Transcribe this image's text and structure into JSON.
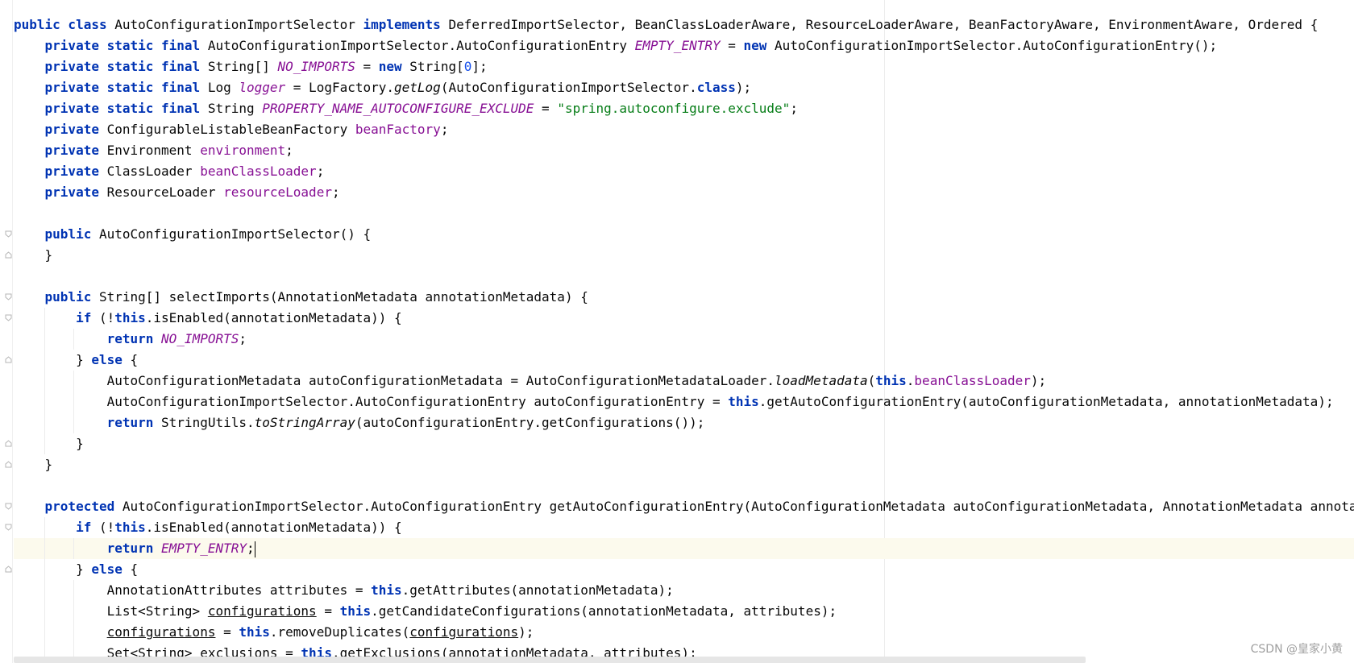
{
  "editor": {
    "lines": [
      [
        [
          "kw",
          "public class "
        ],
        [
          "t",
          "AutoConfigurationImportSelector "
        ],
        [
          "kw",
          "implements "
        ],
        [
          "t",
          "DeferredImportSelector, BeanClassLoaderAware, ResourceLoaderAware, BeanFactoryAware, EnvironmentAware, Ordered {"
        ]
      ],
      [
        [
          "t",
          "    "
        ],
        [
          "kw",
          "private static final "
        ],
        [
          "t",
          "AutoConfigurationImportSelector.AutoConfigurationEntry "
        ],
        [
          "const",
          "EMPTY_ENTRY"
        ],
        [
          "t",
          " = "
        ],
        [
          "kw",
          "new "
        ],
        [
          "t",
          "AutoConfigurationImportSelector.AutoConfigurationEntry();"
        ]
      ],
      [
        [
          "t",
          "    "
        ],
        [
          "kw",
          "private static final "
        ],
        [
          "t",
          "String[] "
        ],
        [
          "const",
          "NO_IMPORTS"
        ],
        [
          "t",
          " = "
        ],
        [
          "kw",
          "new "
        ],
        [
          "t",
          "String["
        ],
        [
          "num",
          "0"
        ],
        [
          "t",
          "];"
        ]
      ],
      [
        [
          "t",
          "    "
        ],
        [
          "kw",
          "private static final "
        ],
        [
          "t",
          "Log "
        ],
        [
          "const",
          "logger"
        ],
        [
          "t",
          " = LogFactory."
        ],
        [
          "sm",
          "getLog"
        ],
        [
          "t",
          "(AutoConfigurationImportSelector."
        ],
        [
          "kw",
          "class"
        ],
        [
          "t",
          ");"
        ]
      ],
      [
        [
          "t",
          "    "
        ],
        [
          "kw",
          "private static final "
        ],
        [
          "t",
          "String "
        ],
        [
          "const",
          "PROPERTY_NAME_AUTOCONFIGURE_EXCLUDE"
        ],
        [
          "t",
          " = "
        ],
        [
          "str",
          "\"spring.autoconfigure.exclude\""
        ],
        [
          "t",
          ";"
        ]
      ],
      [
        [
          "t",
          "    "
        ],
        [
          "kw",
          "private "
        ],
        [
          "t",
          "ConfigurableListableBeanFactory "
        ],
        [
          "field",
          "beanFactory"
        ],
        [
          "t",
          ";"
        ]
      ],
      [
        [
          "t",
          "    "
        ],
        [
          "kw",
          "private "
        ],
        [
          "t",
          "Environment "
        ],
        [
          "field",
          "environment"
        ],
        [
          "t",
          ";"
        ]
      ],
      [
        [
          "t",
          "    "
        ],
        [
          "kw",
          "private "
        ],
        [
          "t",
          "ClassLoader "
        ],
        [
          "field",
          "beanClassLoader"
        ],
        [
          "t",
          ";"
        ]
      ],
      [
        [
          "t",
          "    "
        ],
        [
          "kw",
          "private "
        ],
        [
          "t",
          "ResourceLoader "
        ],
        [
          "field",
          "resourceLoader"
        ],
        [
          "t",
          ";"
        ]
      ],
      [],
      [
        [
          "t",
          "    "
        ],
        [
          "kw",
          "public "
        ],
        [
          "t",
          "AutoConfigurationImportSelector() {"
        ]
      ],
      [
        [
          "t",
          "    }"
        ]
      ],
      [],
      [
        [
          "t",
          "    "
        ],
        [
          "kw",
          "public "
        ],
        [
          "t",
          "String[] selectImports(AnnotationMetadata annotationMetadata) {"
        ]
      ],
      [
        [
          "t",
          "        "
        ],
        [
          "kw",
          "if "
        ],
        [
          "t",
          "(!"
        ],
        [
          "kw",
          "this"
        ],
        [
          "t",
          ".isEnabled(annotationMetadata)) {"
        ]
      ],
      [
        [
          "t",
          "            "
        ],
        [
          "kw",
          "return "
        ],
        [
          "const",
          "NO_IMPORTS"
        ],
        [
          "t",
          ";"
        ]
      ],
      [
        [
          "t",
          "        } "
        ],
        [
          "kw",
          "else "
        ],
        [
          "t",
          "{"
        ]
      ],
      [
        [
          "t",
          "            AutoConfigurationMetadata autoConfigurationMetadata = AutoConfigurationMetadataLoader."
        ],
        [
          "sm",
          "loadMetadata"
        ],
        [
          "t",
          "("
        ],
        [
          "kw",
          "this"
        ],
        [
          "t",
          "."
        ],
        [
          "field",
          "beanClassLoader"
        ],
        [
          "t",
          ");"
        ]
      ],
      [
        [
          "t",
          "            AutoConfigurationImportSelector.AutoConfigurationEntry autoConfigurationEntry = "
        ],
        [
          "kw",
          "this"
        ],
        [
          "t",
          ".getAutoConfigurationEntry(autoConfigurationMetadata, annotationMetadata);"
        ]
      ],
      [
        [
          "t",
          "            "
        ],
        [
          "kw",
          "return "
        ],
        [
          "t",
          "StringUtils."
        ],
        [
          "sm",
          "toStringArray"
        ],
        [
          "t",
          "(autoConfigurationEntry.getConfigurations());"
        ]
      ],
      [
        [
          "t",
          "        }"
        ]
      ],
      [
        [
          "t",
          "    }"
        ]
      ],
      [],
      [
        [
          "t",
          "    "
        ],
        [
          "kw",
          "protected "
        ],
        [
          "t",
          "AutoConfigurationImportSelector.AutoConfigurationEntry getAutoConfigurationEntry(AutoConfigurationMetadata autoConfigurationMetadata, AnnotationMetadata annotationMetadata"
        ]
      ],
      [
        [
          "t",
          "        "
        ],
        [
          "kw",
          "if "
        ],
        [
          "t",
          "(!"
        ],
        [
          "kw",
          "this"
        ],
        [
          "t",
          ".isEnabled(annotationMetadata)) {"
        ]
      ],
      [
        [
          "t",
          "            "
        ],
        [
          "kw",
          "return "
        ],
        [
          "const",
          "EMPTY_ENTRY"
        ],
        [
          "t",
          ";"
        ],
        [
          "caret",
          ""
        ]
      ],
      [
        [
          "t",
          "        } "
        ],
        [
          "kw",
          "else "
        ],
        [
          "t",
          "{"
        ]
      ],
      [
        [
          "t",
          "            AnnotationAttributes attributes = "
        ],
        [
          "kw",
          "this"
        ],
        [
          "t",
          ".getAttributes(annotationMetadata);"
        ]
      ],
      [
        [
          "t",
          "            List<String> "
        ],
        [
          "u",
          "configurations"
        ],
        [
          "t",
          " = "
        ],
        [
          "kw",
          "this"
        ],
        [
          "t",
          ".getCandidateConfigurations(annotationMetadata, attributes);"
        ]
      ],
      [
        [
          "t",
          "            "
        ],
        [
          "u",
          "configurations"
        ],
        [
          "t",
          " = "
        ],
        [
          "kw",
          "this"
        ],
        [
          "t",
          ".removeDuplicates("
        ],
        [
          "u",
          "configurations"
        ],
        [
          "t",
          ");"
        ]
      ],
      [
        [
          "t",
          "            Set<String> exclusions = "
        ],
        [
          "kw",
          "this"
        ],
        [
          "t",
          ".getExclusions(annotationMetadata, attributes);"
        ]
      ]
    ],
    "current_line": 25,
    "watermark": "CSDN @皇家小黄"
  }
}
